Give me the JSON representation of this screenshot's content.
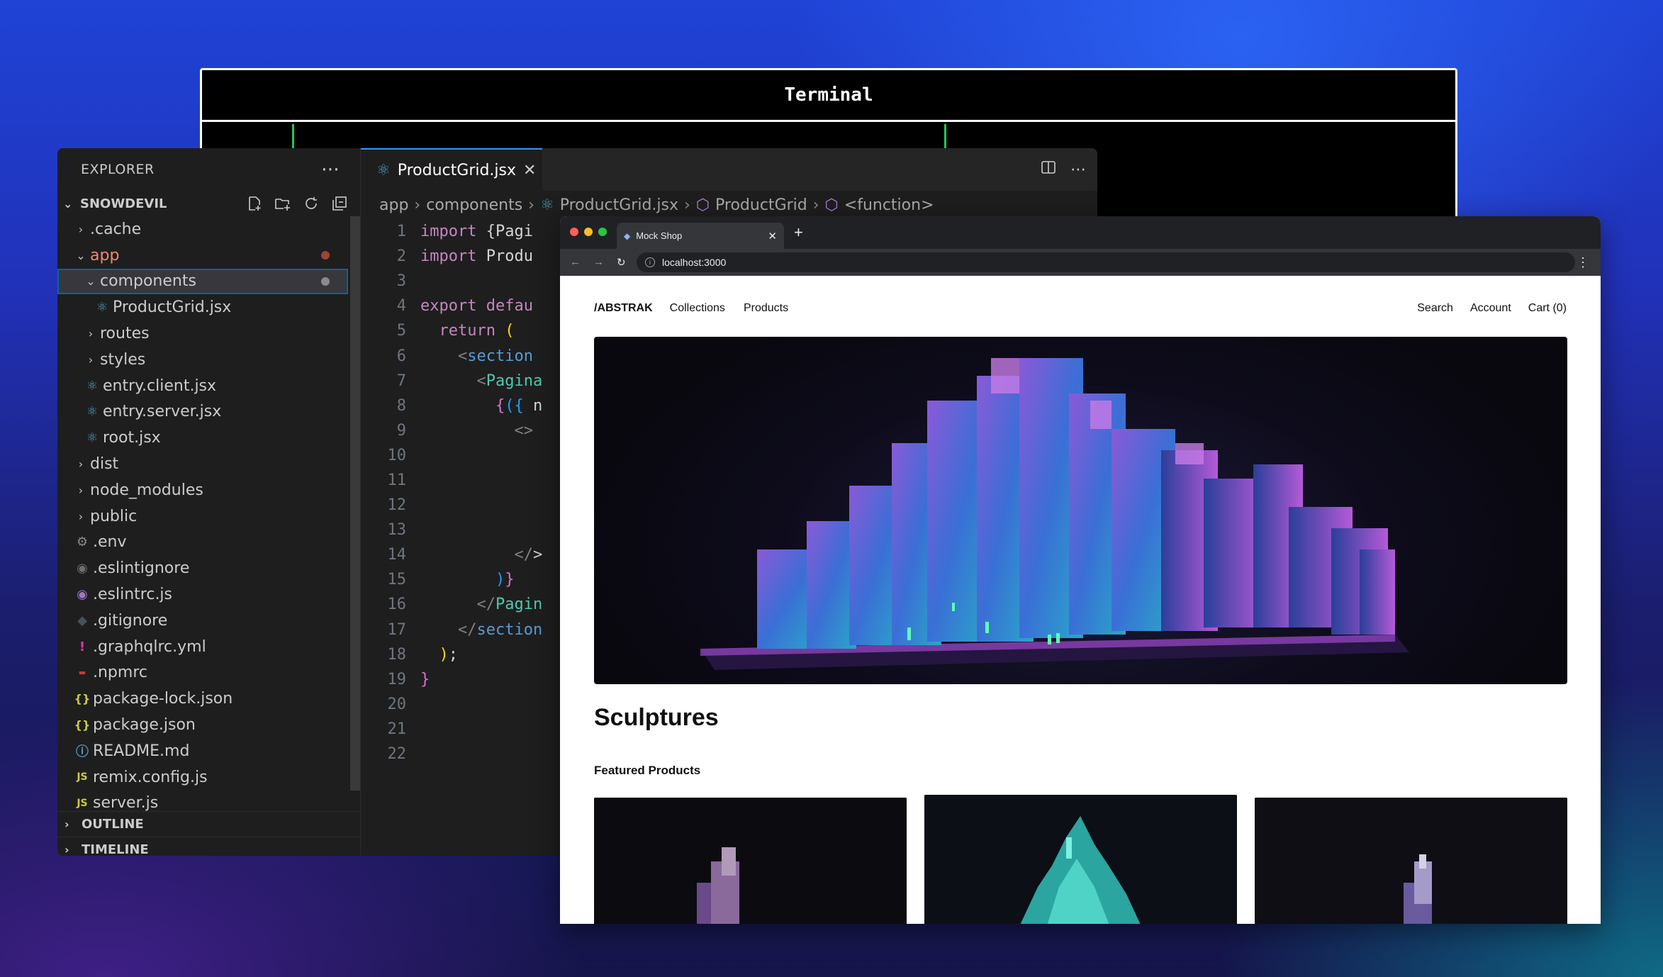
{
  "terminal": {
    "title": "Terminal"
  },
  "vscode": {
    "explorer_title": "EXPLORER",
    "more_icon": "ellipsis-icon",
    "project": "SNOWDEVIL",
    "tree": [
      {
        "label": ".cache",
        "icon": "chevron-right",
        "indent": 1
      },
      {
        "label": "app",
        "icon": "chevron-down",
        "indent": 1,
        "modified": true
      },
      {
        "label": "components",
        "icon": "chevron-down",
        "indent": 2,
        "selected": true,
        "modified": true
      },
      {
        "label": "ProductGrid.jsx",
        "icon": "react-icon",
        "indent": 3
      },
      {
        "label": "routes",
        "icon": "chevron-right",
        "indent": 2
      },
      {
        "label": "styles",
        "icon": "chevron-right",
        "indent": 2
      },
      {
        "label": "entry.client.jsx",
        "icon": "react-icon",
        "indent": 2
      },
      {
        "label": "entry.server.jsx",
        "icon": "react-icon",
        "indent": 2
      },
      {
        "label": "root.jsx",
        "icon": "react-icon",
        "indent": 2
      },
      {
        "label": "dist",
        "icon": "chevron-right",
        "indent": 1
      },
      {
        "label": "node_modules",
        "icon": "chevron-right",
        "indent": 1
      },
      {
        "label": "public",
        "icon": "chevron-right",
        "indent": 1
      },
      {
        "label": ".env",
        "icon": "gear-icon",
        "indent": 1
      },
      {
        "label": ".eslintignore",
        "icon": "circle-icon",
        "indent": 1
      },
      {
        "label": ".eslintrc.js",
        "icon": "eslint-icon",
        "indent": 1
      },
      {
        "label": ".gitignore",
        "icon": "git-icon",
        "indent": 1
      },
      {
        "label": ".graphqlrc.yml",
        "icon": "exclamation-icon",
        "indent": 1
      },
      {
        "label": ".npmrc",
        "icon": "npm-icon",
        "indent": 1
      },
      {
        "label": "package-lock.json",
        "icon": "json-icon",
        "indent": 1
      },
      {
        "label": "package.json",
        "icon": "json-icon",
        "indent": 1
      },
      {
        "label": "README.md",
        "icon": "info-icon",
        "indent": 1
      },
      {
        "label": "remix.config.js",
        "icon": "js-icon",
        "indent": 1
      },
      {
        "label": "server.js",
        "icon": "js-icon",
        "indent": 1
      }
    ],
    "outline": "OUTLINE",
    "timeline": "TIMELINE",
    "tab": "ProductGrid.jsx",
    "breadcrumb": [
      "app",
      "components",
      "ProductGrid.jsx",
      "ProductGrid",
      "<function>"
    ],
    "code_lines": [
      [
        [
          "kw",
          "import "
        ],
        [
          "ctext",
          "{Pagi"
        ]
      ],
      [
        [
          "kw",
          "import "
        ],
        [
          "ctext",
          "Produ"
        ]
      ],
      [],
      [
        [
          "kw",
          "export "
        ],
        [
          "kw",
          "defau"
        ]
      ],
      [
        [
          "ctext",
          "  "
        ],
        [
          "kw",
          "return "
        ],
        [
          "br",
          "("
        ]
      ],
      [
        [
          "ctext",
          "    "
        ],
        [
          "gy",
          "<"
        ],
        [
          "tg2",
          "section"
        ]
      ],
      [
        [
          "ctext",
          "      "
        ],
        [
          "gy",
          "<"
        ],
        [
          "tag",
          "Pagina"
        ]
      ],
      [
        [
          "ctext",
          "        "
        ],
        [
          "br2",
          "{"
        ],
        [
          "br3",
          "({ "
        ],
        [
          "ctext",
          "n"
        ]
      ],
      [
        [
          "ctext",
          "          "
        ],
        [
          "gy",
          "<>"
        ]
      ],
      [
        [
          "ctext",
          "            "
        ]
      ],
      [],
      [],
      [
        [
          "ctext",
          "            "
        ]
      ],
      [
        [
          "ctext",
          "          "
        ],
        [
          "gy",
          "</"
        ],
        [
          "ctext",
          "&gt;"
        ]
      ],
      [
        [
          "ctext",
          "        "
        ],
        [
          "br3",
          ")"
        ],
        [
          "br2",
          "}"
        ]
      ],
      [
        [
          "ctext",
          "      "
        ],
        [
          "gy",
          "</"
        ],
        [
          "tag",
          "Pagin"
        ]
      ],
      [
        [
          "ctext",
          "    "
        ],
        [
          "gy",
          "</"
        ],
        [
          "tg2",
          "section"
        ]
      ],
      [
        [
          "ctext",
          "  "
        ],
        [
          "br",
          ")"
        ],
        [
          "ctext",
          ";"
        ]
      ],
      [
        [
          "br2",
          "}"
        ]
      ],
      [],
      [],
      []
    ]
  },
  "browser": {
    "tab_title": "Mock Shop",
    "url": "localhost:3000",
    "site": {
      "logo": "/ABSTRAK",
      "nav": [
        "Collections",
        "Products"
      ],
      "nav_right": [
        "Search",
        "Account",
        "Cart (0)"
      ],
      "heading": "Sculptures",
      "featured": "Featured Products"
    }
  },
  "colors": {
    "accent": "#3794ff",
    "modified_dot": "#8b8b8b",
    "js_icon": "#cbcb41",
    "json_icon": "#cbcb41",
    "react_icon": "#519aba",
    "npm_icon": "#cb3837",
    "info_icon": "#519aba",
    "eslint_icon": "#a074c4",
    "graphql_icon": "#e535ab"
  }
}
